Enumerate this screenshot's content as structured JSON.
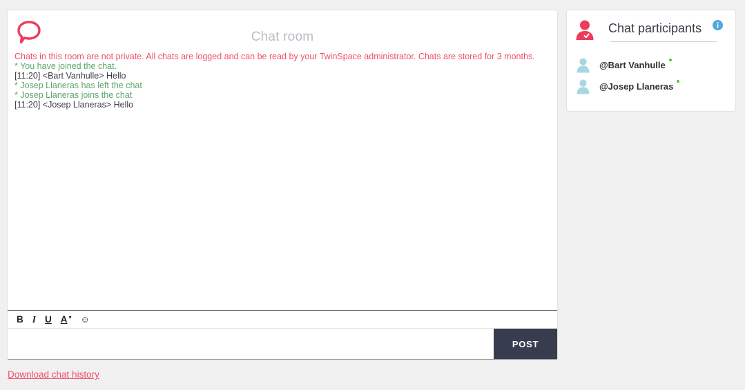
{
  "page": {
    "background_color": "#f0f0f0"
  },
  "chat_panel": {
    "title": "Chat room",
    "icon": "speech-bubble-icon",
    "accent_color": "#ef4f6b",
    "log": [
      {
        "type": "notice",
        "text": "Chats in this room are not private. All chats are logged and can be read by your TwinSpace administrator. Chats are stored for 3 months."
      },
      {
        "type": "system",
        "text": "* You have joined the chat."
      },
      {
        "type": "message",
        "text": "[11:20] <Bart Vanhulle> Hello"
      },
      {
        "type": "system",
        "text": "* Josep Llaneras has left the chat"
      },
      {
        "type": "system",
        "text": "* Josep Llaneras joins the chat"
      },
      {
        "type": "message",
        "text": "[11:20] <Josep Llaneras> Hello"
      }
    ],
    "toolbar": {
      "bold_label": "B",
      "italic_label": "I",
      "underline_label": "U",
      "color_label": "A",
      "color_caret": "▾",
      "emoji_label": "☺"
    },
    "input": {
      "value": "",
      "placeholder": ""
    },
    "post_label": "POST",
    "post_color": "#373d4f"
  },
  "download": {
    "label": "Download chat history",
    "color": "#ef4f6b"
  },
  "participants_panel": {
    "title": "Chat participants",
    "icon": "person-check-icon",
    "info_icon": "info-icon",
    "info_color": "#4fa8dd",
    "online_color": "#5bc236",
    "items": [
      {
        "name": "@Bart Vanhulle",
        "status": "online"
      },
      {
        "name": "@Josep Llaneras",
        "status": "online"
      }
    ]
  }
}
